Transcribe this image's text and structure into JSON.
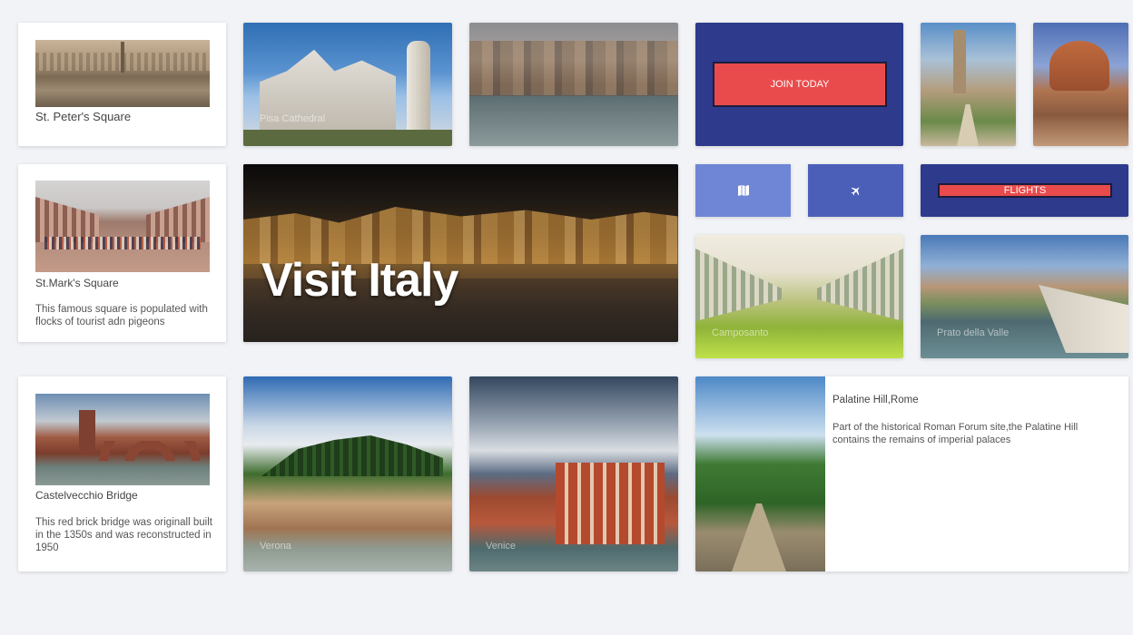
{
  "cards": {
    "st_peters": {
      "title": "St. Peter's Square"
    },
    "st_marks": {
      "title": "St.Mark's Square",
      "desc": "This famous square is populated with flocks of tourist adn pigeons"
    },
    "castelvecchio": {
      "title": "Castelvecchio Bridge",
      "desc": "This red brick bridge was originall built in the 1350s and was reconstructed in 1950"
    },
    "palatine": {
      "title": "Palatine Hill,Rome",
      "desc": "Part of the historical Roman Forum site,the Palatine Hill contains the remains of imperial palaces"
    }
  },
  "photos": {
    "pisa": {
      "caption": "Pisa Cathedral"
    },
    "camposanto": {
      "caption": "Camposanto"
    },
    "prato": {
      "caption": "Prato della Valle"
    },
    "verona": {
      "caption": "Verona"
    },
    "venice": {
      "caption": "Venice"
    }
  },
  "hero": {
    "title": "Visit Italy"
  },
  "buttons": {
    "join": "JOIN TODAY",
    "flights": "FLIGHTS"
  },
  "colors": {
    "navy": "#2e3a8c",
    "tile_light": "#6f86d6",
    "tile_mid": "#4c5fb8",
    "red": "#e94b4c"
  },
  "icons": {
    "map": "map-icon",
    "plane": "plane-icon"
  }
}
